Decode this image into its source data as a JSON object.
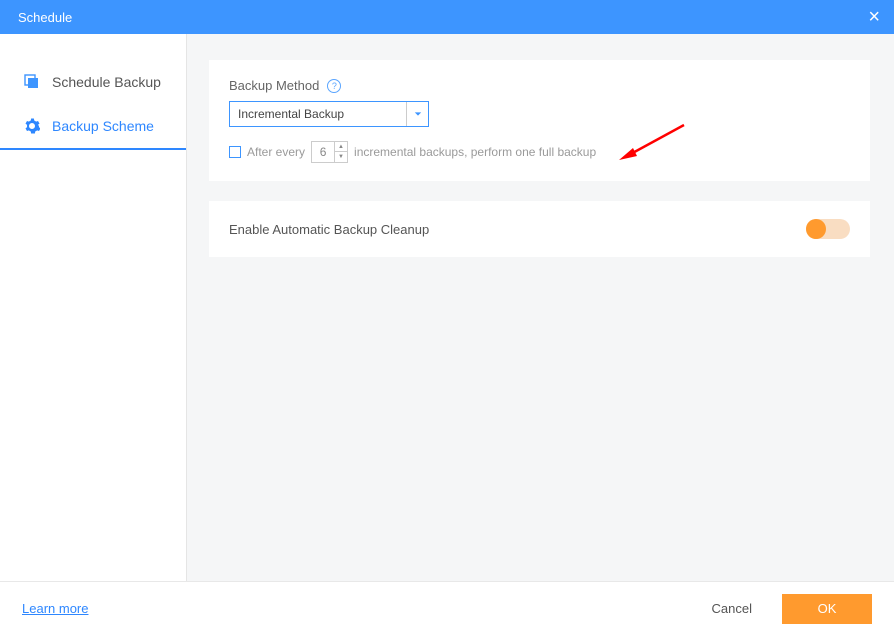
{
  "titlebar": {
    "title": "Schedule"
  },
  "sidebar": {
    "items": [
      {
        "label": "Schedule Backup",
        "active": false
      },
      {
        "label": "Backup Scheme",
        "active": true
      }
    ]
  },
  "backup_method": {
    "label": "Backup Method",
    "selected": "Incremental Backup"
  },
  "after_every": {
    "prefix": "After every",
    "value": "6",
    "suffix": "incremental backups, perform one full backup"
  },
  "cleanup": {
    "label": "Enable Automatic Backup Cleanup",
    "enabled": false
  },
  "footer": {
    "learn_more": "Learn more",
    "cancel": "Cancel",
    "ok": "OK"
  }
}
